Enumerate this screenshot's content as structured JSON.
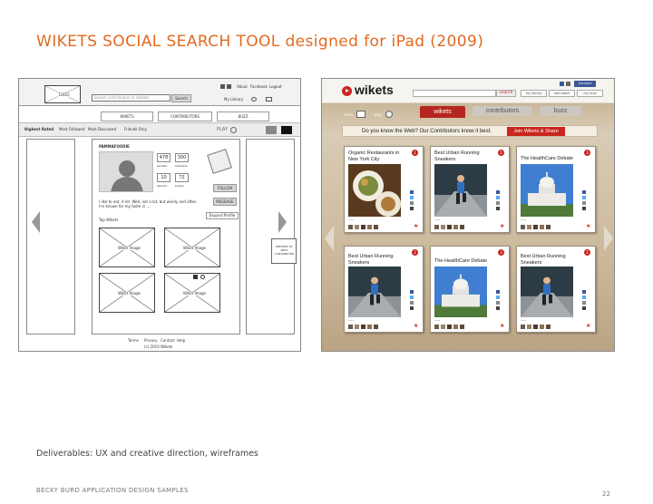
{
  "slide": {
    "title": "WIKETS SOCIAL SEARCH TOOL designed for iPad (2009)",
    "deliverables": "Deliverables: UX and creative direction, wireframes",
    "footer": "BECKY BURD APPLICATION DESIGN SAMPLES",
    "page_number": "22"
  },
  "wireframe": {
    "logo": "LOGO",
    "search_placeholder": "Search contributors or debate",
    "search_button": "Search",
    "top_links": [
      "About",
      "Facebook",
      "Logout"
    ],
    "my_library": "My Library",
    "tabs": [
      "WIKETS",
      "CONTRIBUTORS",
      "BUZZ"
    ],
    "filters": [
      "Highest Rated",
      "Most Followed",
      "Most Discussed",
      "Friends Only"
    ],
    "play_label": "PLAY",
    "profile_name": "PAMMAFOODIE",
    "stats": [
      {
        "value": "478",
        "label": "wickets"
      },
      {
        "value": "300",
        "label": "followers"
      },
      {
        "value": "10",
        "label": "albums"
      },
      {
        "value": "72",
        "label": "trades"
      }
    ],
    "follow_button": "FOLLOW",
    "message_button": "MESSAGE",
    "bio": "I like to eat. A lot. Well, not a lot, but wisely and often. I'm known for my taste in ...",
    "expand_profile": "Expand Profile",
    "top_wikets": "Top Wikets",
    "wiket_image": "Wiket Image",
    "preview_note": "PREVIEW OF NEXT CONTRIBUTOR",
    "footer_links": [
      "Terms",
      "Privacy",
      "Contact",
      "Help"
    ],
    "copyright": "(c) 2010 Wikets"
  },
  "mockup": {
    "brand": "wikets",
    "search_button": "search",
    "header_links": [
      "my library",
      "add wiket",
      "my mail"
    ],
    "facebook_button": "Connect",
    "tabs": [
      "wikets",
      "contributors",
      "buzz"
    ],
    "active_tab": "wikets",
    "show_label": "show",
    "play_label": "play",
    "banner_text": "Do you know the Web? Our Contributors know it best.",
    "join_button": "Join Wikets & Share",
    "cards": [
      {
        "title": "Organic Restaurants in New York City",
        "badge": "1",
        "image": "food"
      },
      {
        "title": "Best Urban Running Sneakers",
        "badge": "2",
        "image": "runner"
      },
      {
        "title": "The HealthCare Debate",
        "badge": "3",
        "image": "capitol"
      },
      {
        "title": "Best Urban Running Sneakers",
        "badge": "2",
        "image": "runner"
      },
      {
        "title": "The HealthCare Debate",
        "badge": "3",
        "image": "capitol"
      },
      {
        "title": "Best Urban Running Sneakers",
        "badge": "2",
        "image": "runner"
      }
    ],
    "colors": {
      "accent": "#c8251c",
      "tab_active": "#b5271e",
      "banner": "#f3ede2"
    }
  }
}
